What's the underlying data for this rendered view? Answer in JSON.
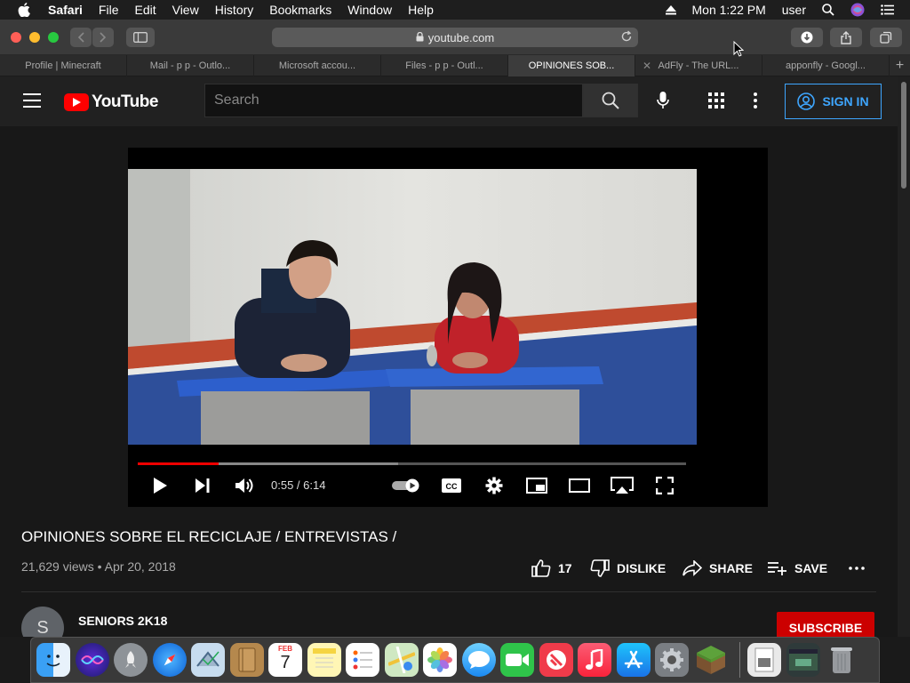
{
  "menubar": {
    "app": "Safari",
    "items": [
      "File",
      "Edit",
      "View",
      "History",
      "Bookmarks",
      "Window",
      "Help"
    ],
    "clock": "Mon 1:22 PM",
    "user": "user"
  },
  "toolbar": {
    "url": "youtube.com"
  },
  "tabs": [
    {
      "label": "Profile | Minecraft"
    },
    {
      "label": "Mail - p p - Outlo..."
    },
    {
      "label": "Microsoft accou..."
    },
    {
      "label": "Files - p p - Outl..."
    },
    {
      "label": "OPINIONES SOB..."
    },
    {
      "label": "AdFly - The URL..."
    },
    {
      "label": "apponfly - Googl..."
    }
  ],
  "youtube": {
    "logo_text": "YouTube",
    "search_placeholder": "Search",
    "signin_label": "SIGN IN",
    "player": {
      "time": "0:55 / 6:14",
      "progress": 0.147
    },
    "video": {
      "title": "OPINIONES SOBRE EL RECICLAJE / ENTREVISTAS /",
      "views": "21,629 views",
      "date": "Apr 20, 2018",
      "likes": "17",
      "dislike_label": "DISLIKE",
      "share_label": "SHARE",
      "save_label": "SAVE"
    },
    "channel": {
      "avatar_letter": "S",
      "name": "SENIORS 2K18",
      "subscribe_label": "SUBSCRIBE"
    }
  },
  "dock": {
    "apps": [
      "finder-icon",
      "siri-icon",
      "launchpad-icon",
      "safari-icon",
      "mail-icon",
      "notes-book-icon",
      "calendar-icon",
      "notes-icon",
      "reminders-icon",
      "maps-icon",
      "photos-icon",
      "messages-icon",
      "facetime-icon",
      "news-icon",
      "music-icon",
      "app-store-icon",
      "system-preferences-icon",
      "minecraft-icon",
      "preview-icon",
      "screenshot-icon",
      "trash-icon"
    ],
    "calendar_month": "FEB",
    "calendar_day": "7"
  },
  "colors": {
    "youtube_red": "#ff0000",
    "signin_blue": "#3ea6ff",
    "subscribe_red": "#cc0000"
  }
}
